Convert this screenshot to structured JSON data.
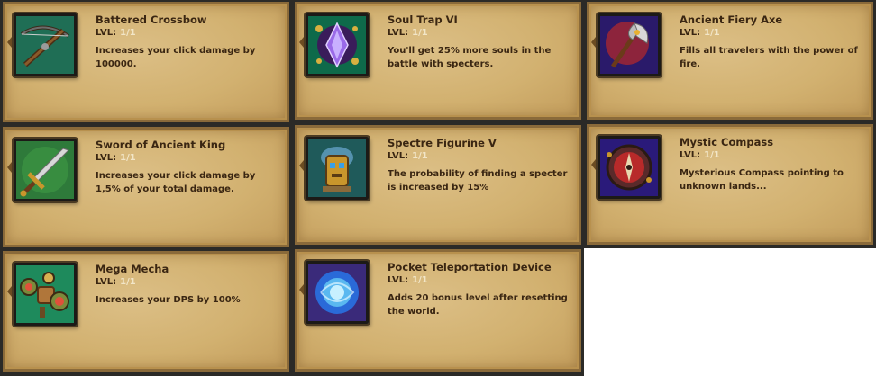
{
  "level_label": "LVL:",
  "items": [
    {
      "title": "Battered Crossbow",
      "level": "1/1",
      "description": "Increases your click damage by 100000.",
      "icon": "crossbow-icon"
    },
    {
      "title": "Sword of Ancient King",
      "level": "1/1",
      "description": "Increases your click damage by 1,5% of your total damage.",
      "icon": "sword-icon"
    },
    {
      "title": "Mega Mecha",
      "level": "1/1",
      "description": "Increases your DPS by 100%",
      "icon": "mecha-icon"
    },
    {
      "title": "Soul Trap VI",
      "level": "1/1",
      "description": "You'll get 25% more souls in the battle with specters.",
      "icon": "soul-trap-icon"
    },
    {
      "title": "Spectre Figurine V",
      "level": "1/1",
      "description": "The probability of finding a specter is increased by 15%",
      "icon": "figurine-icon"
    },
    {
      "title": "Pocket Teleportation Device",
      "level": "1/1",
      "description": "Adds 20 bonus level after resetting the world.",
      "icon": "teleport-orb-icon"
    },
    {
      "title": "Ancient Fiery Axe",
      "level": "1/1",
      "description": "Fills all travelers with the power of fire.",
      "icon": "fiery-axe-icon"
    },
    {
      "title": "Mystic Compass",
      "level": "1/1",
      "description": "Mysterious Compass pointing to unknown lands...",
      "icon": "compass-icon"
    }
  ]
}
